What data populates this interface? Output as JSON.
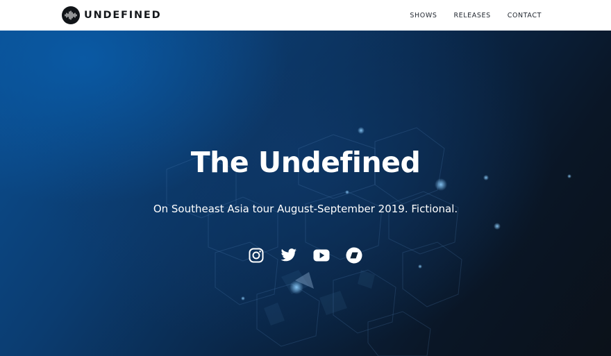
{
  "header": {
    "brand": "UNDEFINED",
    "nav": [
      {
        "label": "SHOWS"
      },
      {
        "label": "RELEASES"
      },
      {
        "label": "CONTACT"
      }
    ]
  },
  "hero": {
    "title": "The Undefined",
    "subtitle": "On Southeast Asia tour August-September 2019. Fictional."
  },
  "social": [
    {
      "icon": "instagram-icon"
    },
    {
      "icon": "twitter-icon"
    },
    {
      "icon": "youtube-icon"
    },
    {
      "icon": "bandcamp-icon"
    }
  ],
  "colors": {
    "nav_text": "#222831",
    "hero_blue": "#0b4f92",
    "hero_dark": "#0b1119"
  }
}
